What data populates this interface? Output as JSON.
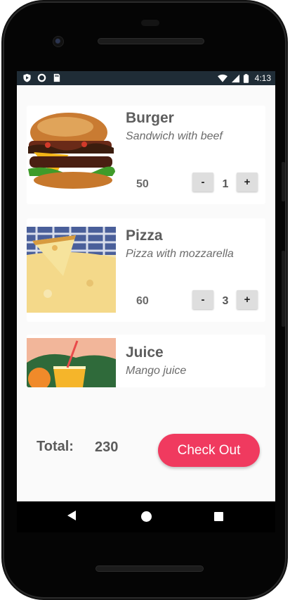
{
  "status_bar": {
    "time": "4:13"
  },
  "items": [
    {
      "name": "Burger",
      "description": "Sandwich with beef",
      "price": "50",
      "quantity": "1",
      "minus": "-",
      "plus": "+"
    },
    {
      "name": "Pizza",
      "description": "Pizza with mozzarella",
      "price": "60",
      "quantity": "3",
      "minus": "-",
      "plus": "+"
    },
    {
      "name": "Juice",
      "description": "Mango juice"
    }
  ],
  "footer": {
    "total_label": "Total:",
    "total_value": "230",
    "checkout_label": "Check Out"
  },
  "colors": {
    "accent": "#f03a5f",
    "status_bar": "#1f2c36",
    "background": "#fafafa",
    "card": "#ffffff"
  }
}
